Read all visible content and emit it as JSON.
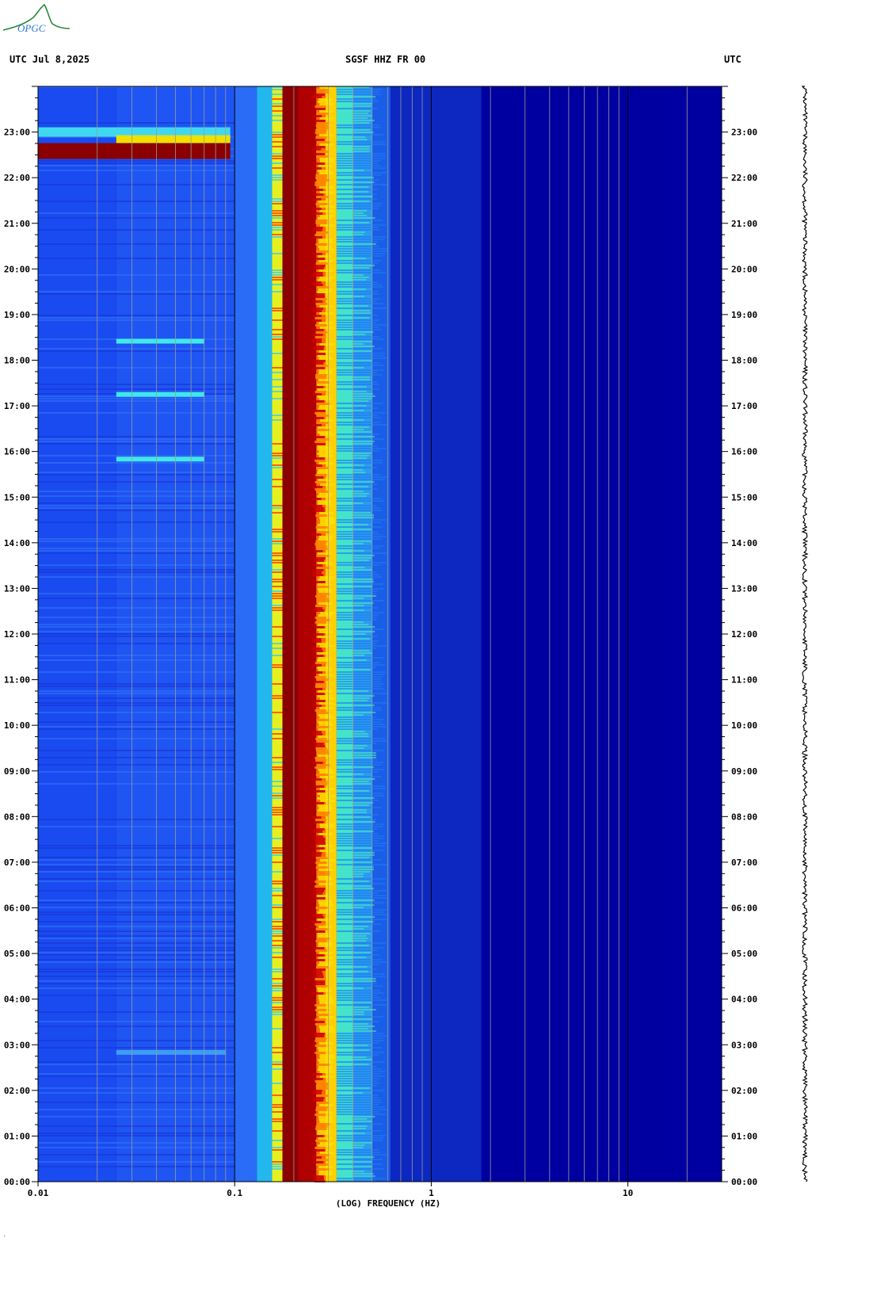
{
  "header": {
    "left": "UTC  Jul 8,2025",
    "center": "SGSF HHZ FR 00",
    "right": "UTC"
  },
  "logo": {
    "text": "OPGC",
    "color": "#2a8a3a"
  },
  "colors": {
    "background": "#0000a0",
    "low": "#1a3ee6",
    "mid": "#1ad0e6",
    "yellow": "#f0f000",
    "orange": "#ff7a00",
    "red": "#cc0000",
    "dark_red": "#8b0000"
  },
  "chart_data": {
    "type": "heatmap",
    "title": "SGSF HHZ FR 00",
    "xlabel": "(LOG) FREQUENCY (HZ)",
    "ylabel": "",
    "x_scale": "log",
    "xlim": [
      0.01,
      30
    ],
    "x_ticks": [
      {
        "value": 0.01,
        "label": "0.01"
      },
      {
        "value": 0.1,
        "label": "0.1"
      },
      {
        "value": 1,
        "label": "1"
      },
      {
        "value": 10,
        "label": "10"
      }
    ],
    "ylim_hours": [
      0,
      24
    ],
    "y_ticks": [
      "00:00",
      "01:00",
      "02:00",
      "03:00",
      "04:00",
      "05:00",
      "06:00",
      "07:00",
      "08:00",
      "09:00",
      "10:00",
      "11:00",
      "12:00",
      "13:00",
      "14:00",
      "15:00",
      "16:00",
      "17:00",
      "18:00",
      "19:00",
      "20:00",
      "21:00",
      "22:00",
      "23:00"
    ],
    "microseism_band_hz": [
      0.17,
      0.3
    ],
    "dominant_peak_hz": 0.22,
    "events": [
      {
        "time": "22:35",
        "freq_range_hz": [
          0.01,
          0.095
        ],
        "intensity": "dark_red"
      },
      {
        "time": "18:25",
        "freq_range_hz": [
          0.025,
          0.07
        ],
        "intensity": "cyan"
      },
      {
        "time": "17:15",
        "freq_range_hz": [
          0.025,
          0.07
        ],
        "intensity": "cyan"
      },
      {
        "time": "15:50",
        "freq_range_hz": [
          0.025,
          0.07
        ],
        "intensity": "cyan"
      },
      {
        "time": "02:50",
        "freq_range_hz": [
          0.025,
          0.09
        ],
        "intensity": "light"
      }
    ]
  }
}
